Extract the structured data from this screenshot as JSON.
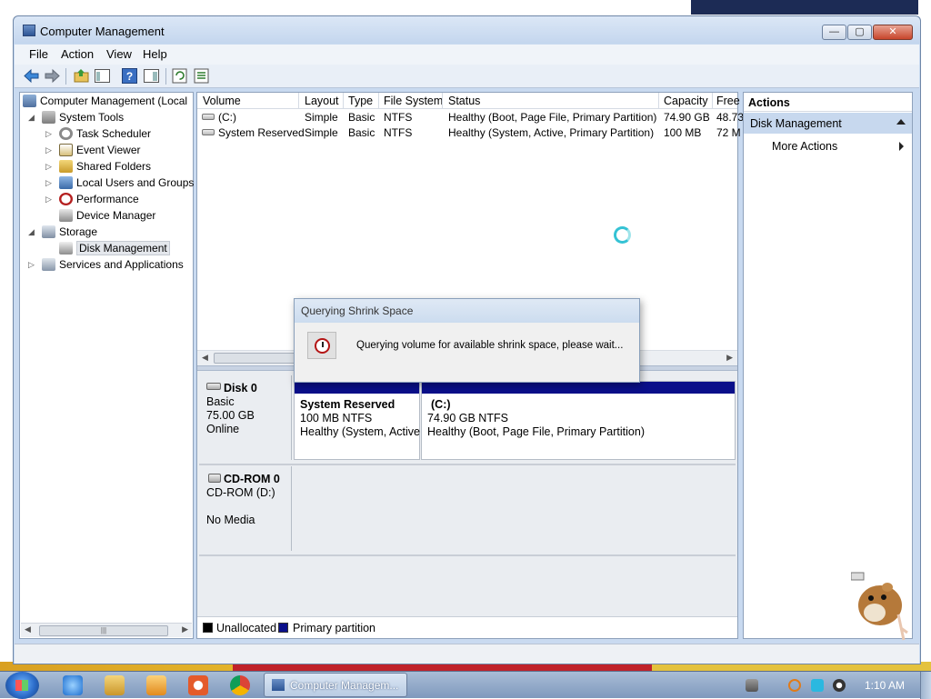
{
  "window": {
    "title": "Computer Management",
    "controls": {
      "minimize": "—",
      "maximize": "▢",
      "close": "✕"
    }
  },
  "menu": [
    "File",
    "Action",
    "View",
    "Help"
  ],
  "tree": {
    "root": "Computer Management (Local",
    "system_tools": "System Tools",
    "task_scheduler": "Task Scheduler",
    "event_viewer": "Event Viewer",
    "shared_folders": "Shared Folders",
    "local_users": "Local Users and Groups",
    "performance": "Performance",
    "device_manager": "Device Manager",
    "storage": "Storage",
    "disk_management": "Disk Management",
    "services": "Services and Applications"
  },
  "volumes": {
    "headers": {
      "volume": "Volume",
      "layout": "Layout",
      "type": "Type",
      "fs": "File System",
      "status": "Status",
      "capacity": "Capacity",
      "free": "Free"
    },
    "rows": [
      {
        "volume": "(C:)",
        "layout": "Simple",
        "type": "Basic",
        "fs": "NTFS",
        "status": "Healthy (Boot, Page File, Primary Partition)",
        "capacity": "74.90 GB",
        "free": "48.73"
      },
      {
        "volume": "System Reserved",
        "layout": "Simple",
        "type": "Basic",
        "fs": "NTFS",
        "status": "Healthy (System, Active, Primary Partition)",
        "capacity": "100 MB",
        "free": "72 M"
      }
    ]
  },
  "disks": {
    "disk0": {
      "name": "Disk 0",
      "type": "Basic",
      "size": "75.00 GB",
      "state": "Online"
    },
    "part_sys": {
      "name": "System Reserved",
      "size": "100 MB NTFS",
      "status": "Healthy (System, Active"
    },
    "part_c": {
      "name": "(C:)",
      "size": "74.90 GB NTFS",
      "status": "Healthy (Boot, Page File, Primary Partition)"
    },
    "cdrom": {
      "name": "CD-ROM 0",
      "drive": "CD-ROM (D:)",
      "media": "No Media"
    }
  },
  "legend": {
    "unallocated": "Unallocated",
    "primary": "Primary partition",
    "unallocated_color": "#000000",
    "primary_color": "#0a0f8a"
  },
  "actions": {
    "header": "Actions",
    "section": "Disk Management",
    "more": "More Actions"
  },
  "dialog": {
    "title": "Querying Shrink Space",
    "message": "Querying volume for available shrink space, please wait..."
  },
  "taskbar": {
    "task_label": "Computer Managem...",
    "clock": "1:10 AM"
  }
}
